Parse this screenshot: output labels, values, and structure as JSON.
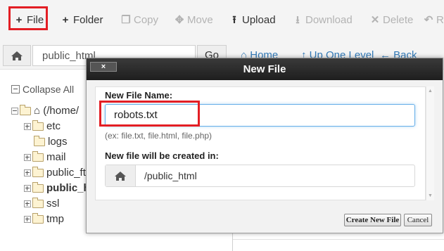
{
  "toolbar": {
    "file_label": "File",
    "folder_label": "Folder",
    "copy_label": "Copy",
    "move_label": "Move",
    "upload_label": "Upload",
    "download_label": "Download",
    "delete_label": "Delete",
    "restore_label": "Re"
  },
  "pathbar": {
    "path_value": "public_html",
    "go_label": "Go",
    "home_link": "Home",
    "up_link": "Up One Level",
    "back_link": "Back"
  },
  "sidebar": {
    "collapse_label": "Collapse All",
    "root_label": "(/home/",
    "items": [
      {
        "label": "etc"
      },
      {
        "label": "logs"
      },
      {
        "label": "mail"
      },
      {
        "label": "public_ft"
      },
      {
        "label": "public_h"
      },
      {
        "label": "ssl"
      },
      {
        "label": "tmp"
      }
    ]
  },
  "modal": {
    "title": "New File",
    "close_label": "×",
    "name_label": "New File Name:",
    "name_value": "robots.txt",
    "hint": "(ex: file.txt, file.html, file.php)",
    "dir_label": "New file will be created in:",
    "dir_value": "/public_html",
    "create_label": "Create New File",
    "cancel_label": "Cancel"
  },
  "colors": {
    "highlight": "#e31e24",
    "link": "#337ab7",
    "modal_header": "#2a2a2a"
  }
}
